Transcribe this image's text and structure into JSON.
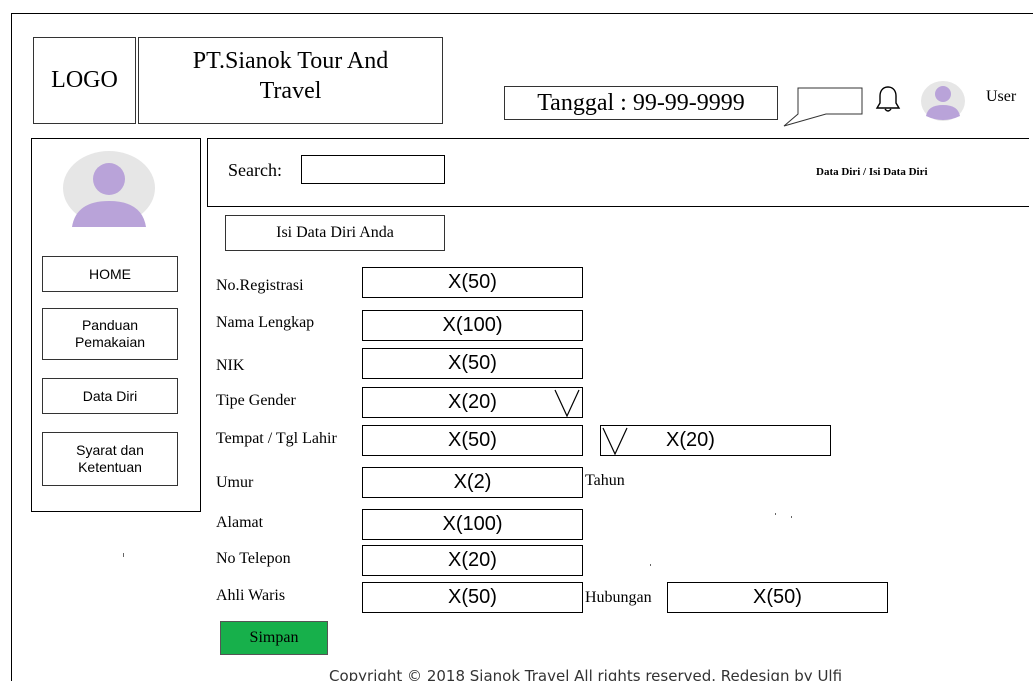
{
  "header": {
    "logo": "LOGO",
    "company_line1": "PT.Sianok Tour And",
    "company_line2": "Travel",
    "date": "Tanggal : 99-99-9999",
    "user": "User"
  },
  "sidebar": {
    "items": [
      {
        "label": "HOME"
      },
      {
        "label": "Panduan Pemakaian"
      },
      {
        "label": "Data Diri"
      },
      {
        "label": "Syarat dan Ketentuan"
      }
    ]
  },
  "search": {
    "label": "Search:",
    "value": ""
  },
  "breadcrumb": "Data Diri / Isi Data Diri",
  "form": {
    "title": "Isi Data Diri Anda",
    "fields": [
      {
        "label": "No.Registrasi",
        "value": "X(50)"
      },
      {
        "label": "Nama Lengkap",
        "value": "X(100)"
      },
      {
        "label": "NIK",
        "value": "X(50)"
      },
      {
        "label": "Tipe Gender",
        "value": "X(20)"
      },
      {
        "label": "Tempat / Tgl Lahir",
        "value": "X(50)",
        "value2": "X(20)"
      },
      {
        "label": "Umur",
        "value": "X(2)",
        "suffix": "Tahun"
      },
      {
        "label": "Alamat",
        "value": "X(100)"
      },
      {
        "label": "No Telepon",
        "value": "X(20)"
      },
      {
        "label": "Ahli Waris",
        "value": "X(50)",
        "label2": "Hubungan",
        "value2": "X(50)"
      }
    ],
    "save_label": "Simpan"
  },
  "footer": {
    "copyright": "Copyright © 2018 Sianok Travel All rights reserved. Redesign by Ulfi"
  },
  "colors": {
    "save_button": "#17b04b",
    "avatar_bg": "#e6e6e6",
    "avatar_figure": "#b9a3d9"
  },
  "icons": [
    "chat-bubble-icon",
    "bell-icon",
    "user-avatar-icon",
    "profile-avatar-icon",
    "dropdown-caret-icon"
  ]
}
